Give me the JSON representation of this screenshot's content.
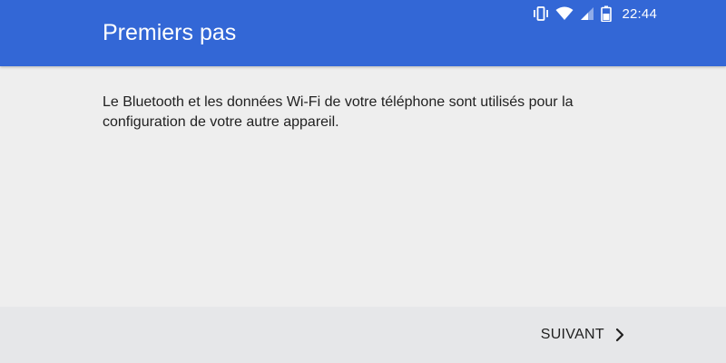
{
  "status_bar": {
    "time": "22:44",
    "icons": [
      "vibrate-icon",
      "wifi-icon",
      "signal-icon",
      "battery-icon"
    ]
  },
  "header": {
    "title": "Premiers pas",
    "color": "#3367d6"
  },
  "content": {
    "message": "Le Bluetooth et les données Wi-Fi de votre téléphone sont utilisés pour la configuration de votre autre appareil."
  },
  "footer": {
    "next_label": "SUIVANT",
    "next_icon": "chevron-right-icon"
  }
}
